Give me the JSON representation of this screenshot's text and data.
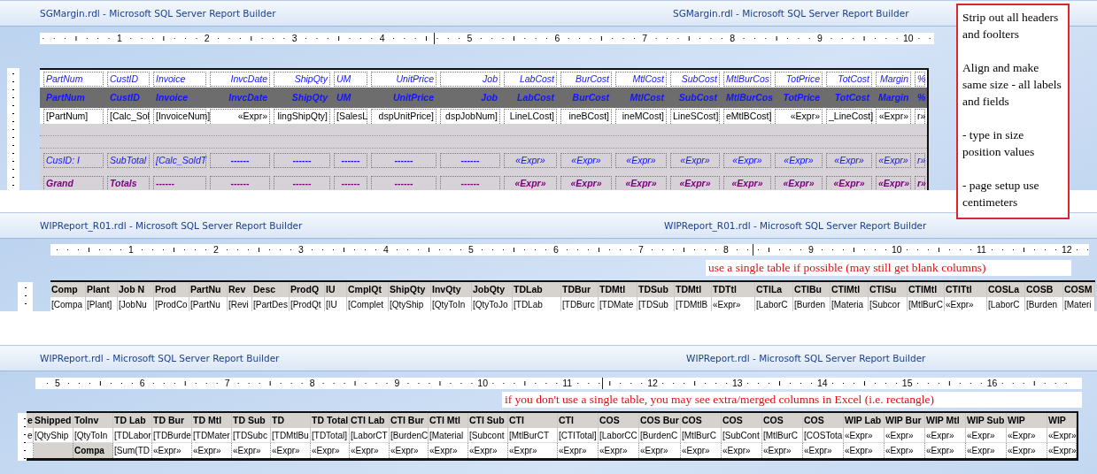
{
  "note": {
    "paragraphs": [
      "Strip out all headers and foolters",
      "Align and make same size - all labels and fields",
      "- type in size position values",
      "- page setup use centimeters"
    ]
  },
  "windows": [
    {
      "title": "SGMargin.rdl - Microsoft SQL Server Report Builder",
      "title_repeat": "SGMargin.rdl - Microsoft SQL Server Report Builder",
      "ruler": [
        "1",
        "2",
        "3",
        "4",
        "5",
        "6",
        "7",
        "8",
        "9",
        "10"
      ],
      "rows": [
        {
          "kind": "label",
          "cells": [
            "PartNum",
            "CustID",
            "Invoice",
            "InvcDate",
            "ShipQty",
            "UM",
            "UnitPrice",
            "Job",
            "LabCost",
            "BurCost",
            "MtlCost",
            "SubCost",
            "MtlBurCos",
            "TotPrice",
            "TotCost",
            "Margin",
            "%"
          ]
        },
        {
          "kind": "header",
          "cells": [
            "PartNum",
            "CustID",
            "Invoice",
            "InvcDate",
            "ShipQty",
            "UM",
            "UnitPrice",
            "Job",
            "LabCost",
            "BurCost",
            "MtlCost",
            "SubCost",
            "MtlBurCos",
            "TotPrice",
            "TotCost",
            "Margin",
            "%"
          ]
        },
        {
          "kind": "detail",
          "cells": [
            "[PartNum]",
            "[Calc_Sol",
            "[InvoiceNum]",
            "«Expr»",
            "lingShipQty]",
            "[SalesL",
            "dspUnitPrice]",
            "dspJobNum]",
            "LineLCost]",
            "ineBCost]",
            "ineMCost]",
            "LineSCost]",
            "eMtlBCost]",
            "«Expr»",
            "_LineCost]",
            "«Expr»",
            "r»"
          ]
        },
        {
          "kind": "blank"
        },
        {
          "kind": "blank"
        },
        {
          "kind": "subtotal",
          "cells": [
            "CusID: I",
            "SubTotal",
            "[Calc_SoldT",
            "------",
            "------",
            "------",
            "------",
            "------",
            "«Expr»",
            "«Expr»",
            "«Expr»",
            "«Expr»",
            "«Expr»",
            "«Expr»",
            "«Expr»",
            "«Expr»",
            "r»"
          ]
        },
        {
          "kind": "grand",
          "cells": [
            "Grand",
            "Totals",
            "------",
            "------",
            "------",
            "------",
            "------",
            "------",
            "«Expr»",
            "«Expr»",
            "«Expr»",
            "«Expr»",
            "«Expr»",
            "«Expr»",
            "«Expr»",
            "«Expr»",
            "r»"
          ]
        }
      ]
    },
    {
      "title": "WIPReport_R01.rdl - Microsoft SQL Server Report Builder",
      "title_repeat": "WIPReport_R01.rdl - Microsoft SQL Server Report Builder",
      "ruler": [
        "1",
        "2",
        "3",
        "4",
        "5",
        "6",
        "7",
        "8",
        "9",
        "10",
        "11",
        "12"
      ],
      "banner": "use a single table if possible (may still get blank columns)",
      "rows": [
        {
          "kind": "header",
          "cells": [
            "Comp",
            "Plant",
            "Job N",
            "Prod",
            "PartNu",
            "Rev",
            "Desc",
            "ProdQ",
            "IU",
            "CmplQt",
            "ShipQty",
            "InvQty",
            "JobQty",
            "TDLab",
            "TDBur",
            "TDMtl",
            "TDSub",
            "TDMtl",
            "TDTtl",
            "CTILa",
            "CTIBu",
            "CTIMtl",
            "CTISu",
            "CTIMtl",
            "CTITtl",
            "COSLa",
            "COSB",
            "COSM"
          ]
        },
        {
          "kind": "detail",
          "cells": [
            "[Compa",
            "[Plant]",
            "[JobNu",
            "[ProdCo",
            "[PartNu",
            "[Revi",
            "[PartDes",
            "[ProdQt",
            "[IU",
            "[Complet",
            "[QtyShip",
            "[QtyToIn",
            "[QtyToJo",
            "[TDLab",
            "[TDBurc",
            "[TDMate",
            "[TDSub",
            "[TDMtlB",
            "«Expr»",
            "[LaborC",
            "[Burden",
            "[Materia",
            "[Subcor",
            "[MtlBurC",
            "«Expr»",
            "[LaborC",
            "[Burden",
            "[Materi"
          ]
        }
      ]
    },
    {
      "title": "WIPReport.rdl - Microsoft SQL Server Report Builder",
      "title_repeat": "WIPReport.rdl - Microsoft SQL Server Report Builder",
      "ruler": [
        "5",
        "6",
        "7",
        "8",
        "9",
        "10",
        "11",
        "12",
        "13",
        "14",
        "15",
        "16"
      ],
      "banner": "if you don't use a single table, you may see extra/merged columns in Excel  (i.e. rectangle)",
      "rows": [
        {
          "kind": "header",
          "cells": [
            "e",
            "Shipped",
            "ToInv",
            "TD Lab",
            "TD Bur",
            "TD Mtl",
            "TD Sub",
            "TD",
            "TD Total",
            "CTI Lab",
            "CTI Bur",
            "CTI Mtl",
            "CTI Sub",
            "CTI",
            "CTI",
            "COS",
            "COS Bur",
            "COS",
            "COS",
            "COS",
            "COS",
            "WIP Lab",
            "WIP Bur",
            "WIP Mtl",
            "WIP Sub",
            "WIP",
            "WIP"
          ]
        },
        {
          "kind": "detail",
          "cells": [
            "e",
            "[QtyShip",
            "[QtyToIn",
            "[TDLabor",
            "[TDBurde",
            "[TDMater",
            "[TDSubc",
            "[TDMtlBu",
            "[TDTotal]",
            "[LaborCT",
            "[BurdenC",
            "[Material",
            "[Subcont",
            "[MtlBurCT",
            "[CTITotal]",
            "[LaborCC",
            "[BurdenC",
            "[MtlBurC",
            "[SubCont",
            "[MtlBurC",
            "[COSTota",
            "«Expr»",
            "«Expr»",
            "«Expr»",
            "«Expr»",
            "«Expr»",
            "«Expr»"
          ]
        },
        {
          "kind": "total",
          "cells": [
            "",
            "",
            "Compa",
            "[Sum(TD",
            "«Expr»",
            "«Expr»",
            "«Expr»",
            "«Expr»",
            "«Expr»",
            "«Expr»",
            "«Expr»",
            "«Expr»",
            "«Expr»",
            "«Expr»",
            "«Expr»",
            "«Expr»",
            "«Expr»",
            "«Expr»",
            "«Expr»",
            "«Expr»",
            "«Expr»",
            "«Expr»",
            "«Expr»",
            "«Expr»",
            "«Expr»",
            "«Expr»",
            "«Expr»"
          ]
        }
      ]
    }
  ]
}
